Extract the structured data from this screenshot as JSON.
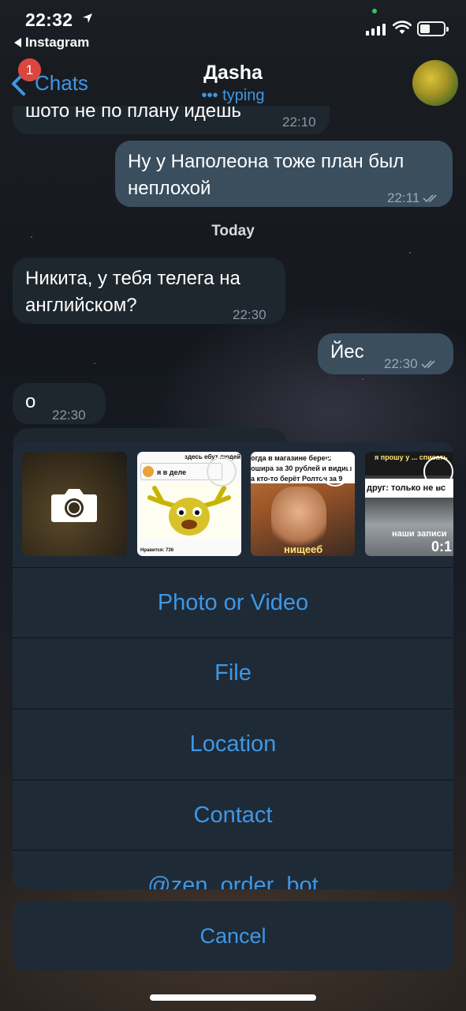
{
  "status_bar": {
    "time": "22:32",
    "back_app": "Instagram"
  },
  "nav": {
    "back_label": "Chats",
    "badge": "1",
    "title": "Дasha",
    "subtitle": "••• typing"
  },
  "messages": [
    {
      "text": "шото не по плану идешь",
      "time": "22:10",
      "dir": "in"
    },
    {
      "text": "Ну у Наполеона тоже план был неплохой",
      "time": "22:11",
      "dir": "out"
    },
    {
      "text": "Никита, у тебя телега на английском?",
      "time": "22:30",
      "dir": "in"
    },
    {
      "text": "Йес",
      "time": "22:30",
      "dir": "out"
    },
    {
      "text": "о",
      "time": "22:30",
      "dir": "in"
    }
  ],
  "date_separator": "Today",
  "thumbnails": [
    {
      "caption_top": "здесь ебут людей",
      "caption": "я в деле",
      "footer": "Нравится: 736"
    },
    {
      "caption": "огда в магазине береш ошира за 30 рублей и видиш а кто-то берёт Ролтон за 9",
      "bottom": "нищееб"
    },
    {
      "caption_top": "я прошу у ... списать",
      "caption": "друг: только не вс",
      "bottom": "наши записи",
      "duration": "0:1"
    }
  ],
  "sheet": {
    "items": [
      "Photo or Video",
      "File",
      "Location",
      "Contact",
      "@zen_order_bot"
    ],
    "cancel": "Cancel"
  },
  "colors": {
    "accent": "#3e97e6",
    "badge": "#d9473e",
    "sheet_bg": "#1f2a37",
    "bubble_out": "#3a4e5e",
    "bubble_in": "#1e262e"
  },
  "icons": [
    "location-arrow-icon",
    "signal-icon",
    "wifi-icon",
    "battery-icon",
    "back-chevron-icon",
    "camera-icon",
    "double-check-icon"
  ]
}
